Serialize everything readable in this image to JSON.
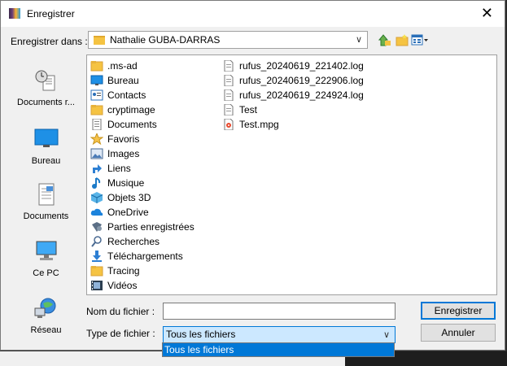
{
  "window": {
    "title": "Enregistrer"
  },
  "location": {
    "label": "Enregistrer dans :",
    "current": "Nathalie GUBA-DARRAS"
  },
  "places": [
    {
      "label": "Documents r...",
      "icon": "recent-documents-icon"
    },
    {
      "label": "Bureau",
      "icon": "desktop-icon"
    },
    {
      "label": "Documents",
      "icon": "documents-icon"
    },
    {
      "label": "Ce PC",
      "icon": "computer-icon"
    },
    {
      "label": "Réseau",
      "icon": "network-icon"
    }
  ],
  "files": {
    "col1": [
      {
        "name": ".ms-ad",
        "icon": "folder-icon"
      },
      {
        "name": "Bureau",
        "icon": "desktop-folder-icon"
      },
      {
        "name": "Contacts",
        "icon": "contacts-icon"
      },
      {
        "name": "cryptimage",
        "icon": "folder-icon"
      },
      {
        "name": "Documents",
        "icon": "documents-folder-icon"
      },
      {
        "name": "Favoris",
        "icon": "star-icon"
      },
      {
        "name": "Images",
        "icon": "images-icon"
      },
      {
        "name": "Liens",
        "icon": "links-icon"
      },
      {
        "name": "Musique",
        "icon": "music-icon"
      },
      {
        "name": "Objets 3D",
        "icon": "3d-objects-icon"
      },
      {
        "name": "OneDrive",
        "icon": "cloud-icon"
      },
      {
        "name": "Parties enregistrées",
        "icon": "saved-games-icon"
      },
      {
        "name": "Recherches",
        "icon": "search-icon"
      },
      {
        "name": "Téléchargements",
        "icon": "download-icon"
      },
      {
        "name": "Tracing",
        "icon": "folder-icon"
      },
      {
        "name": "Vidéos",
        "icon": "video-icon"
      }
    ],
    "col2": [
      {
        "name": "rufus_20240619_221402.log",
        "icon": "file-icon"
      },
      {
        "name": "rufus_20240619_222906.log",
        "icon": "file-icon"
      },
      {
        "name": "rufus_20240619_224924.log",
        "icon": "file-icon"
      },
      {
        "name": "Test",
        "icon": "file-icon"
      },
      {
        "name": "Test.mpg",
        "icon": "media-file-icon"
      }
    ]
  },
  "filename": {
    "label": "Nom du fichier :",
    "value": ""
  },
  "filetype": {
    "label": "Type de fichier :",
    "selected": "Tous les fichiers",
    "options": [
      "Tous les fichiers"
    ]
  },
  "buttons": {
    "save": "Enregistrer",
    "cancel": "Annuler"
  },
  "colors": {
    "accent": "#0078d7",
    "folder": "#f5c342",
    "selection": "#cce8ff"
  }
}
